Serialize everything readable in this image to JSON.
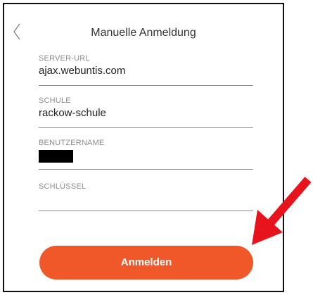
{
  "header": {
    "title": "Manuelle Anmeldung"
  },
  "form": {
    "server_url": {
      "label": "SERVER-URL",
      "value": "ajax.webuntis.com"
    },
    "school": {
      "label": "SCHULE",
      "value": "rackow-schule"
    },
    "username": {
      "label": "BENUTZERNAME",
      "value": ""
    },
    "key": {
      "label": "SCHLÜSSEL",
      "value": ""
    }
  },
  "login_button": {
    "label": "Anmelden"
  },
  "colors": {
    "accent": "#f0582a",
    "annotation_arrow": "#e8141c",
    "label_text": "#8c8c8c"
  },
  "icons": {
    "back": "chevron-left-icon"
  }
}
